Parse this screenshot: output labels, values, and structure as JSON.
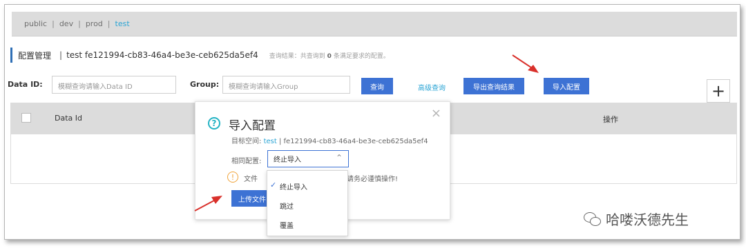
{
  "namespaces": {
    "items": [
      "public",
      "dev",
      "prod",
      "test"
    ],
    "active": "test",
    "separator": "|"
  },
  "header": {
    "title": "配置管理",
    "divider": "|",
    "namespace_label": "test fe121994-cb83-46a4-be3e-ceb625da5ef4",
    "result_prefix": "查询结果：共查询到",
    "result_count": "0",
    "result_suffix": "条满足要求的配置。"
  },
  "filters": {
    "data_id_label": "Data ID:",
    "data_id_placeholder": "模糊查询请输入Data ID",
    "group_label": "Group:",
    "group_placeholder": "模糊查询请输入Group",
    "query_button": "查询",
    "advanced_link": "高级查询",
    "export_button": "导出查询结果",
    "import_button": "导入配置",
    "add_button": "+"
  },
  "table": {
    "columns": [
      "Data Id",
      "操作"
    ]
  },
  "dialog": {
    "title": "导入配置",
    "target_label": "目标空间:",
    "target_ns": "test",
    "target_sep": "|",
    "target_id": "fe121994-cb83-46a4-be3e-ceb625da5ef4",
    "same_config_label": "相同配置:",
    "selected_option": "终止导入",
    "warning_start": "文件",
    "warning_tail": "请务必谨慎操作!",
    "upload_button": "上传文件",
    "close": "×"
  },
  "dropdown": {
    "options": [
      "终止导入",
      "跳过",
      "覆盖"
    ],
    "selected_index": 0
  },
  "watermark": {
    "text": "哈喽沃德先生"
  },
  "colors": {
    "primary": "#3d72d4",
    "link": "#2aa4d4",
    "arrow": "#d9302b",
    "warning": "#f0a339"
  }
}
